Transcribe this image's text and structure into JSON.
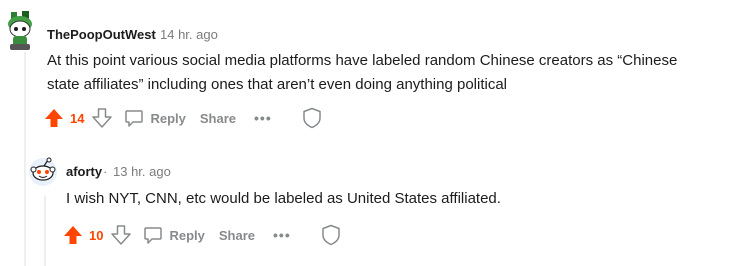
{
  "colors": {
    "accent_upvote": "#ff4500",
    "muted": "#878a8c",
    "thread_line": "#edeff1",
    "text": "#1c1c1c"
  },
  "comments": [
    {
      "username": "ThePoopOutWest",
      "separator": "·",
      "timestamp": "14 hr. ago",
      "body": "At this point various social media platforms have labeled random Chinese creators as “Chinese state affiliates” including ones that aren’t even doing anything political",
      "score": "14",
      "reply_label": "Reply",
      "share_label": "Share",
      "more_label": "•••",
      "avatar_icon": "snoo-avatar-icon"
    },
    {
      "username": "aforty",
      "separator": "·",
      "timestamp": "13 hr. ago",
      "body": "I wish NYT, CNN, etc would be labeled as United States affiliated.",
      "score": "10",
      "reply_label": "Reply",
      "share_label": "Share",
      "more_label": "•••",
      "avatar_icon": "snoo-avatar-icon"
    }
  ]
}
